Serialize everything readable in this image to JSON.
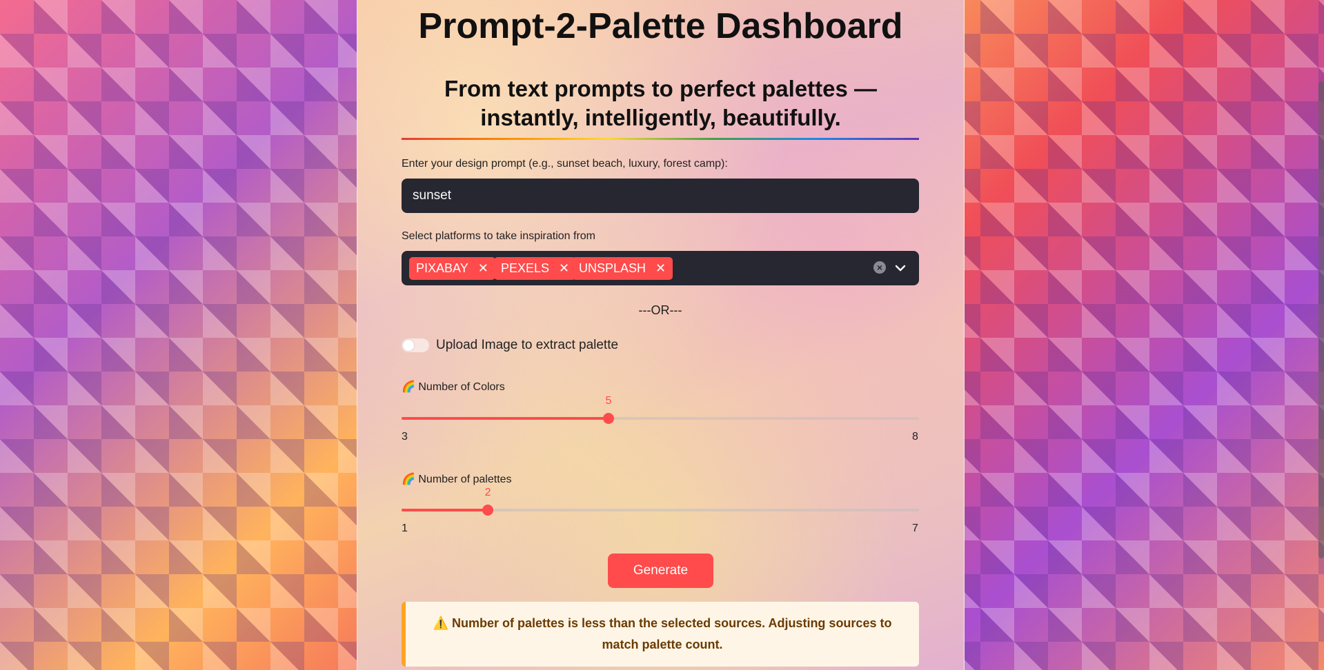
{
  "header": {
    "title": "Prompt-2-Palette Dashboard",
    "subtitle": "From text prompts to perfect palettes — instantly, intelligently, beautifully."
  },
  "prompt": {
    "label": "Enter your design prompt (e.g., sunset beach, luxury, forest camp):",
    "value": "sunset"
  },
  "platforms": {
    "label": "Select platforms to take inspiration from",
    "selected": [
      "PIXABAY",
      "PEXELS",
      "UNSPLASH"
    ]
  },
  "separator": "---OR---",
  "upload_toggle": {
    "label": "Upload Image to extract palette",
    "enabled": false
  },
  "colors_slider": {
    "label": "🌈 Number of Colors",
    "value": "5",
    "min": "3",
    "max": "8"
  },
  "palettes_slider": {
    "label": "🌈 Number of palettes",
    "value": "2",
    "min": "1",
    "max": "7"
  },
  "generate_label": "Generate",
  "warning": {
    "icon": "⚠️",
    "text": "Number of palettes is less than the selected sources. Adjusting sources to match palette count."
  },
  "colors": {
    "accent": "#ff4b4b",
    "input_bg": "#262730",
    "warning_bg": "#fff5e6",
    "warning_border": "#ffa421"
  }
}
